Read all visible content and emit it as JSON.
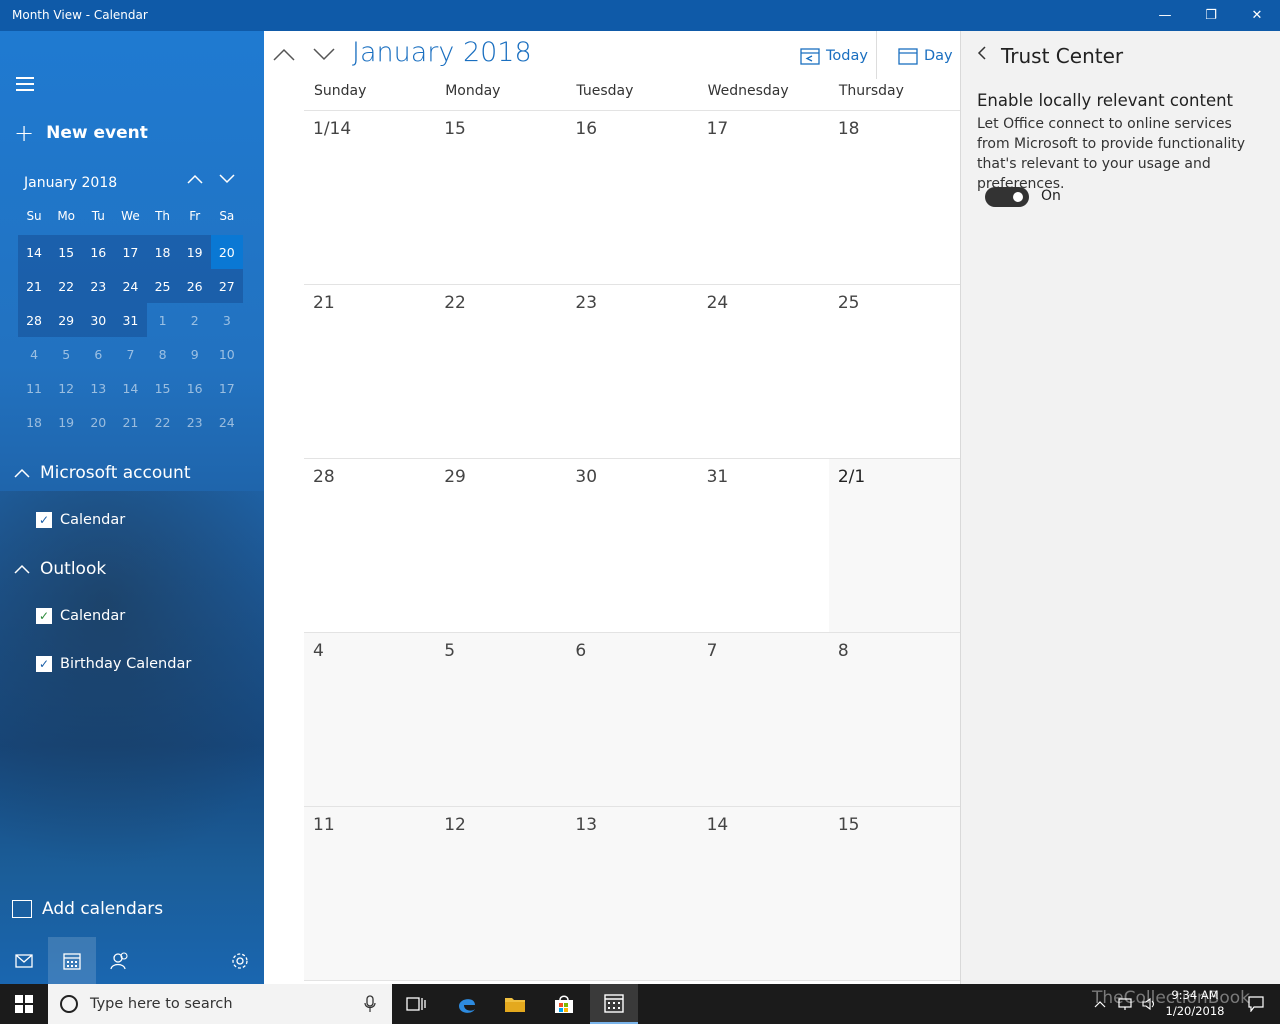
{
  "window": {
    "title": "Month View - Calendar",
    "controls": {
      "minimize": "—",
      "restore": "❐",
      "close": "✕"
    }
  },
  "sidebar": {
    "new_event_plus": "+",
    "new_event_label": "New event",
    "mini_calendar": {
      "title": "January 2018",
      "weekdays": [
        "Su",
        "Mo",
        "Tu",
        "We",
        "Th",
        "Fr",
        "Sa"
      ],
      "weeks": [
        [
          "14",
          "15",
          "16",
          "17",
          "18",
          "19",
          "20"
        ],
        [
          "21",
          "22",
          "23",
          "24",
          "25",
          "26",
          "27"
        ],
        [
          "28",
          "29",
          "30",
          "31",
          "1",
          "2",
          "3"
        ],
        [
          "4",
          "5",
          "6",
          "7",
          "8",
          "9",
          "10"
        ],
        [
          "11",
          "12",
          "13",
          "14",
          "15",
          "16",
          "17"
        ],
        [
          "18",
          "19",
          "20",
          "21",
          "22",
          "23",
          "24"
        ]
      ],
      "selected_day": "20"
    },
    "accounts": [
      {
        "name": "Microsoft account",
        "calendars": [
          {
            "name": "Calendar",
            "check_color": "#1a5fa8"
          }
        ]
      },
      {
        "name": "Outlook",
        "calendars": [
          {
            "name": "Calendar",
            "check_color": "#2e8b3a"
          },
          {
            "name": "Birthday Calendar",
            "check_color": "#1a5fa8"
          }
        ]
      }
    ],
    "checkmark": "✓",
    "collapse_chevron": "^",
    "add_calendars_label": "Add calendars"
  },
  "main": {
    "month_title": "January 2018",
    "today_label": "Today",
    "day_label": "Day",
    "weekday_headers": [
      "Sunday",
      "Monday",
      "Tuesday",
      "Wednesday",
      "Thursday"
    ],
    "weeks": [
      [
        "1/14",
        "15",
        "16",
        "17",
        "18"
      ],
      [
        "21",
        "22",
        "23",
        "24",
        "25"
      ],
      [
        "28",
        "29",
        "30",
        "31",
        "2/1"
      ],
      [
        "4",
        "5",
        "6",
        "7",
        "8"
      ],
      [
        "11",
        "12",
        "13",
        "14",
        "15"
      ]
    ]
  },
  "trust_center": {
    "title": "Trust Center",
    "section_title": "Enable locally relevant content",
    "description": "Let Office connect to online services from Microsoft to provide functionality that's relevant to your usage and preferences.",
    "toggle_state": "On"
  },
  "taskbar": {
    "search_placeholder": "Type here to search",
    "clock_time": "9:34 AM",
    "clock_date": "1/20/2018",
    "watermark": "TheCollectionBook"
  },
  "colors": {
    "accent": "#1a6fc0",
    "titlebar": "#0f5aa8",
    "today_highlight": "#0a78d4"
  }
}
